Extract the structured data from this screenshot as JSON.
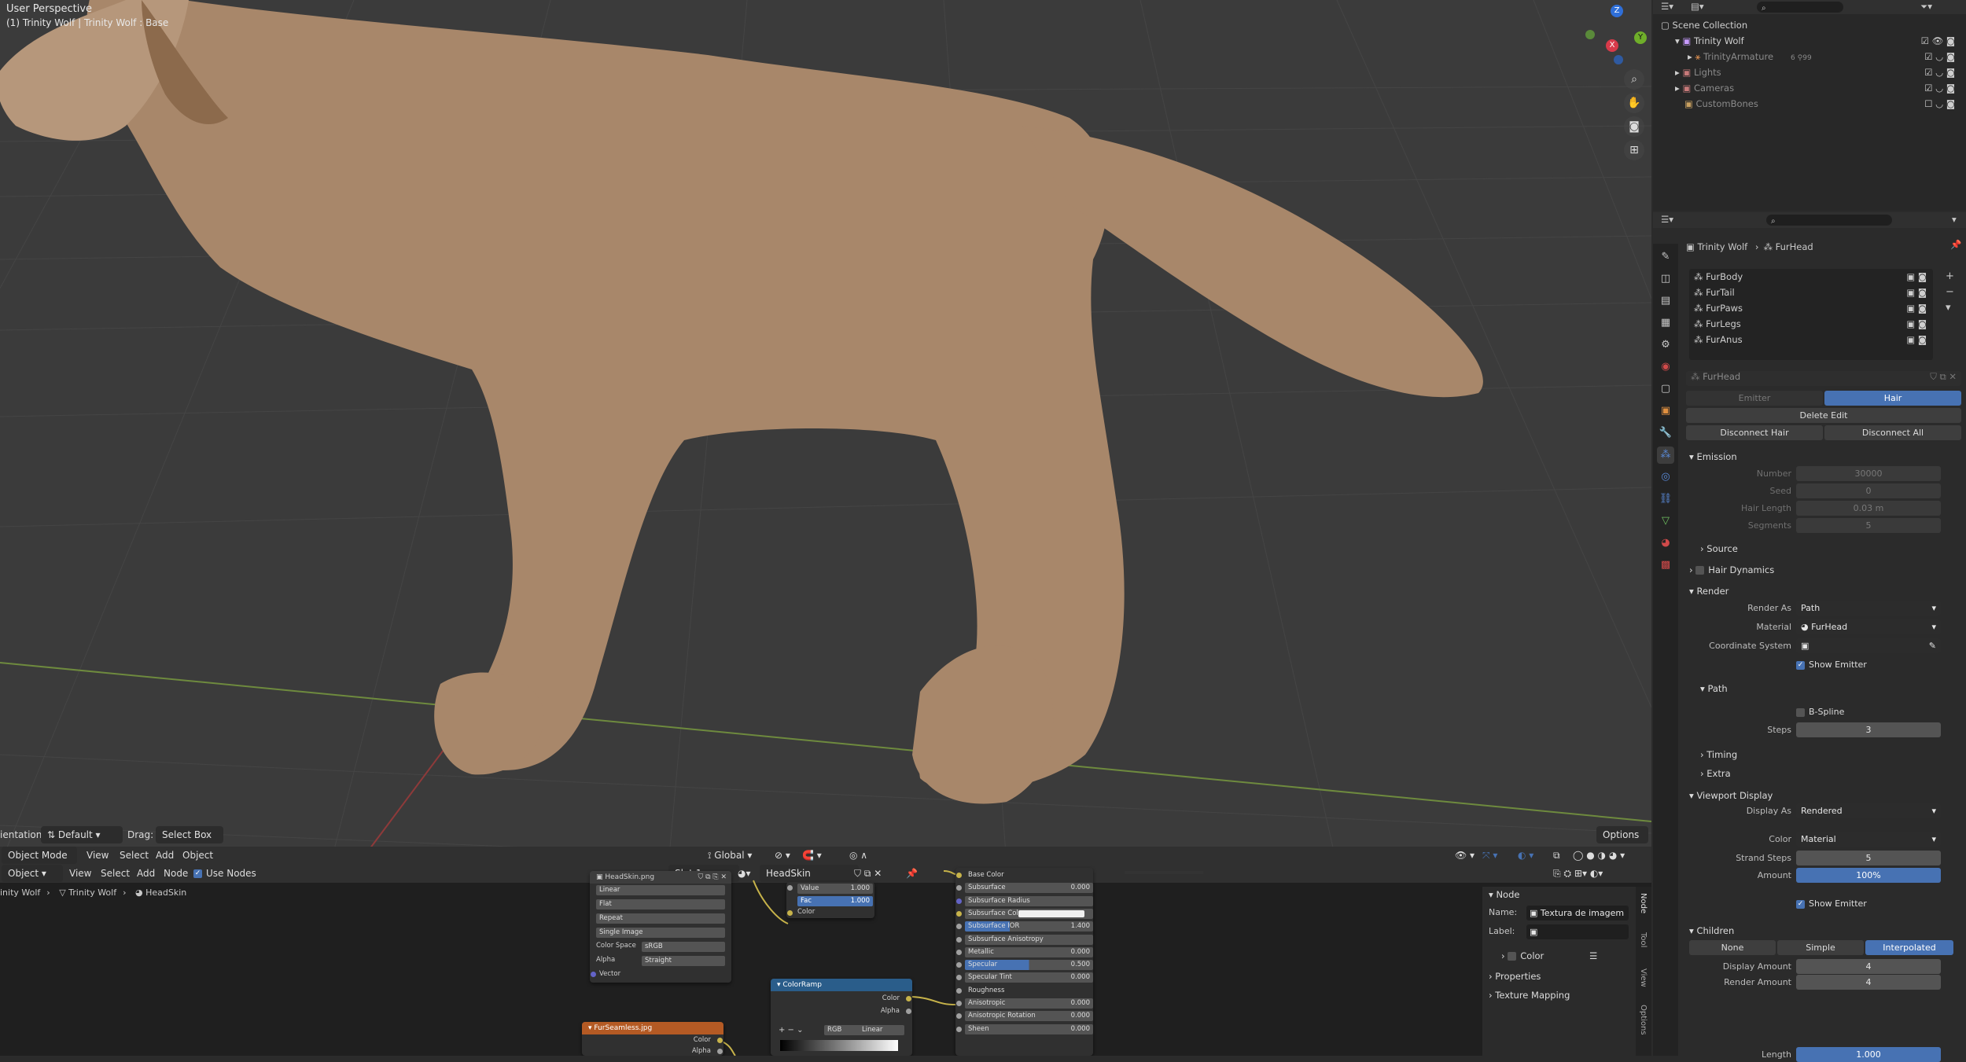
{
  "viewport": {
    "title": "User Perspective",
    "subtitle": "(1) Trinity Wolf | Trinity Wolf : Base",
    "orientation_label": "ientation:",
    "orientation_value": "Default",
    "drag_label": "Drag:",
    "drag_value": "Select Box",
    "options_label": "Options",
    "transform_orientation": "Global",
    "gizmo_labels": {
      "z": "Z",
      "y": "Y",
      "x": "X"
    }
  },
  "outliner": {
    "root": "Scene Collection",
    "items": [
      {
        "label": "Trinity Wolf",
        "dim": false
      },
      {
        "label": "TrinityArmature",
        "dim": true,
        "extra": "6  ⚲99"
      },
      {
        "label": "Lights",
        "dim": true
      },
      {
        "label": "Cameras",
        "dim": true
      },
      {
        "label": "CustomBones",
        "dim": true
      }
    ]
  },
  "properties": {
    "breadcrumb": {
      "object": "Trinity Wolf",
      "system": "FurHead"
    },
    "particle_systems": [
      "FurBody",
      "FurTail",
      "FurPaws",
      "FurLegs",
      "FurAnus"
    ],
    "settings_name": "FurHead",
    "type_tabs": [
      "Emitter",
      "Hair"
    ],
    "buttons": {
      "delete_edit": "Delete Edit",
      "disconnect_hair": "Disconnect Hair",
      "disconnect_all": "Disconnect All"
    },
    "emission": {
      "title": "Emission",
      "fields": [
        {
          "label": "Number",
          "value": "30000"
        },
        {
          "label": "Seed",
          "value": "0"
        },
        {
          "label": "Hair Length",
          "value": "0.03 m"
        },
        {
          "label": "Segments",
          "value": "5"
        }
      ],
      "source": "Source"
    },
    "hair_dynamics": "Hair Dynamics",
    "render": {
      "title": "Render",
      "render_as_label": "Render As",
      "render_as": "Path",
      "material_label": "Material",
      "material": "FurHead",
      "coord_label": "Coordinate System",
      "show_emitter": "Show Emitter",
      "path": "Path",
      "bspline": "B-Spline",
      "steps_label": "Steps",
      "steps": "3",
      "timing": "Timing",
      "extra": "Extra"
    },
    "viewport_display": {
      "title": "Viewport Display",
      "display_as_label": "Display As",
      "display_as": "Rendered",
      "color_label": "Color",
      "color": "Material",
      "strand_steps_label": "Strand Steps",
      "strand_steps": "5",
      "amount_label": "Amount",
      "amount": "100%",
      "show_emitter": "Show Emitter"
    },
    "children": {
      "title": "Children",
      "modes": [
        "None",
        "Simple",
        "Interpolated"
      ],
      "display_amount_label": "Display Amount",
      "display_amount": "4",
      "render_amount_label": "Render Amount",
      "render_amount": "4",
      "length_label": "Length",
      "length": "1.000"
    }
  },
  "node_editor": {
    "header": {
      "object_mode": "Object Mode",
      "menu": [
        "View",
        "Select",
        "Add",
        "Object"
      ],
      "editor_type": "Object",
      "menu2": [
        "View",
        "Select",
        "Add",
        "Node"
      ],
      "use_nodes": "Use Nodes",
      "slot": "Slot 1",
      "material": "HeadSkin"
    },
    "breadcrumb": [
      "inity Wolf",
      "Trinity Wolf",
      "HeadSkin"
    ],
    "image_node": {
      "title": "HeadSkin.png",
      "rows": [
        "Linear",
        "Flat",
        "Repeat",
        "Single Image"
      ],
      "color_space_label": "Color Space",
      "color_space": "sRGB",
      "alpha_label": "Alpha",
      "alpha": "Straight",
      "vector": "Vector"
    },
    "furseamless_node": {
      "title": "FurSeamless.jpg",
      "outputs": [
        "Color",
        "Alpha"
      ]
    },
    "mix_node": {
      "value_label": "Value",
      "value": "1.000",
      "fac_label": "Fac",
      "fac": "1.000",
      "color": "Color"
    },
    "colorramp_node": {
      "title": "ColorRamp",
      "outputs": [
        "Color",
        "Alpha"
      ],
      "mode": "RGB",
      "interp": "Linear"
    },
    "bsdf_node": {
      "rows": [
        {
          "label": "Base Color",
          "value": ""
        },
        {
          "label": "Subsurface",
          "value": "0.000"
        },
        {
          "label": "Subsurface Radius",
          "value": ""
        },
        {
          "label": "Subsurface Col...",
          "value": ""
        },
        {
          "label": "Subsurface IOR",
          "value": "1.400"
        },
        {
          "label": "Subsurface Anisotropy",
          "value": ""
        },
        {
          "label": "Metallic",
          "value": "0.000"
        },
        {
          "label": "Specular",
          "value": "0.500"
        },
        {
          "label": "Specular Tint",
          "value": "0.000"
        },
        {
          "label": "Roughness",
          "value": ""
        },
        {
          "label": "Anisotropic",
          "value": "0.000"
        },
        {
          "label": "Anisotropic Rotation",
          "value": "0.000"
        },
        {
          "label": "Sheen",
          "value": "0.000"
        }
      ]
    },
    "sidebar": {
      "section": "Node",
      "name_label": "Name:",
      "name": "Textura de imagem",
      "label_label": "Label:",
      "color": "Color",
      "properties": "Properties",
      "texture_mapping": "Texture Mapping",
      "tabs": [
        "Node",
        "Tool",
        "View",
        "Options"
      ]
    }
  },
  "colors": {
    "accent": "#4772b3",
    "viewport_bg": "#3b3b3b",
    "fur": "#a8876a"
  }
}
